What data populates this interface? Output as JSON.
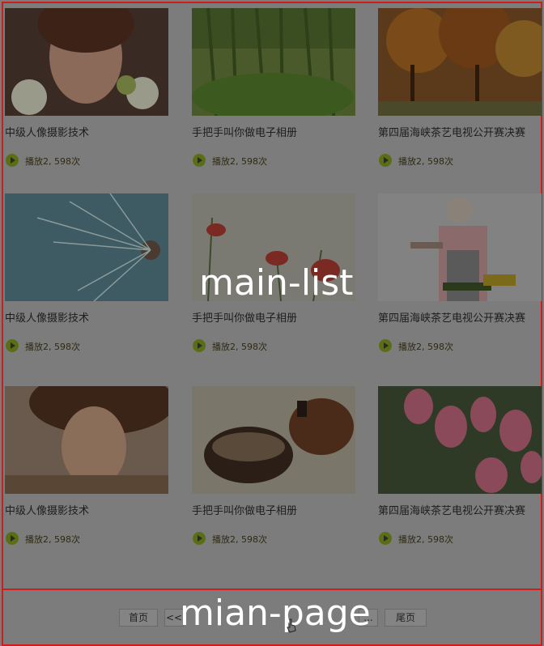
{
  "annotations": {
    "list_label": "main-list",
    "page_label": "mian-page"
  },
  "cards": [
    {
      "title": "中级人像摄影技术",
      "plays": "播放2, 598次"
    },
    {
      "title": "手把手叫你做电子相册",
      "plays": "播放2, 598次"
    },
    {
      "title": "第四届海峡茶艺电视公开赛决赛",
      "plays": "播放2, 598次"
    },
    {
      "title": "中级人像摄影技术",
      "plays": "播放2, 598次"
    },
    {
      "title": "手把手叫你做电子相册",
      "plays": "播放2, 598次"
    },
    {
      "title": "第四届海峡茶艺电视公开赛决赛",
      "plays": "播放2, 598次"
    },
    {
      "title": "中级人像摄影技术",
      "plays": "播放2, 598次"
    },
    {
      "title": "手把手叫你做电子相册",
      "plays": "播放2, 598次"
    },
    {
      "title": "第四届海峡茶艺电视公开赛决赛",
      "plays": "播放2, 598次"
    }
  ],
  "pagination": {
    "first": "首页",
    "prev": "<<",
    "ellipsis": "...",
    "last": "尾页"
  },
  "colors": {
    "frame_border": "#d21c1c",
    "overlay": "#7c7c7c"
  }
}
